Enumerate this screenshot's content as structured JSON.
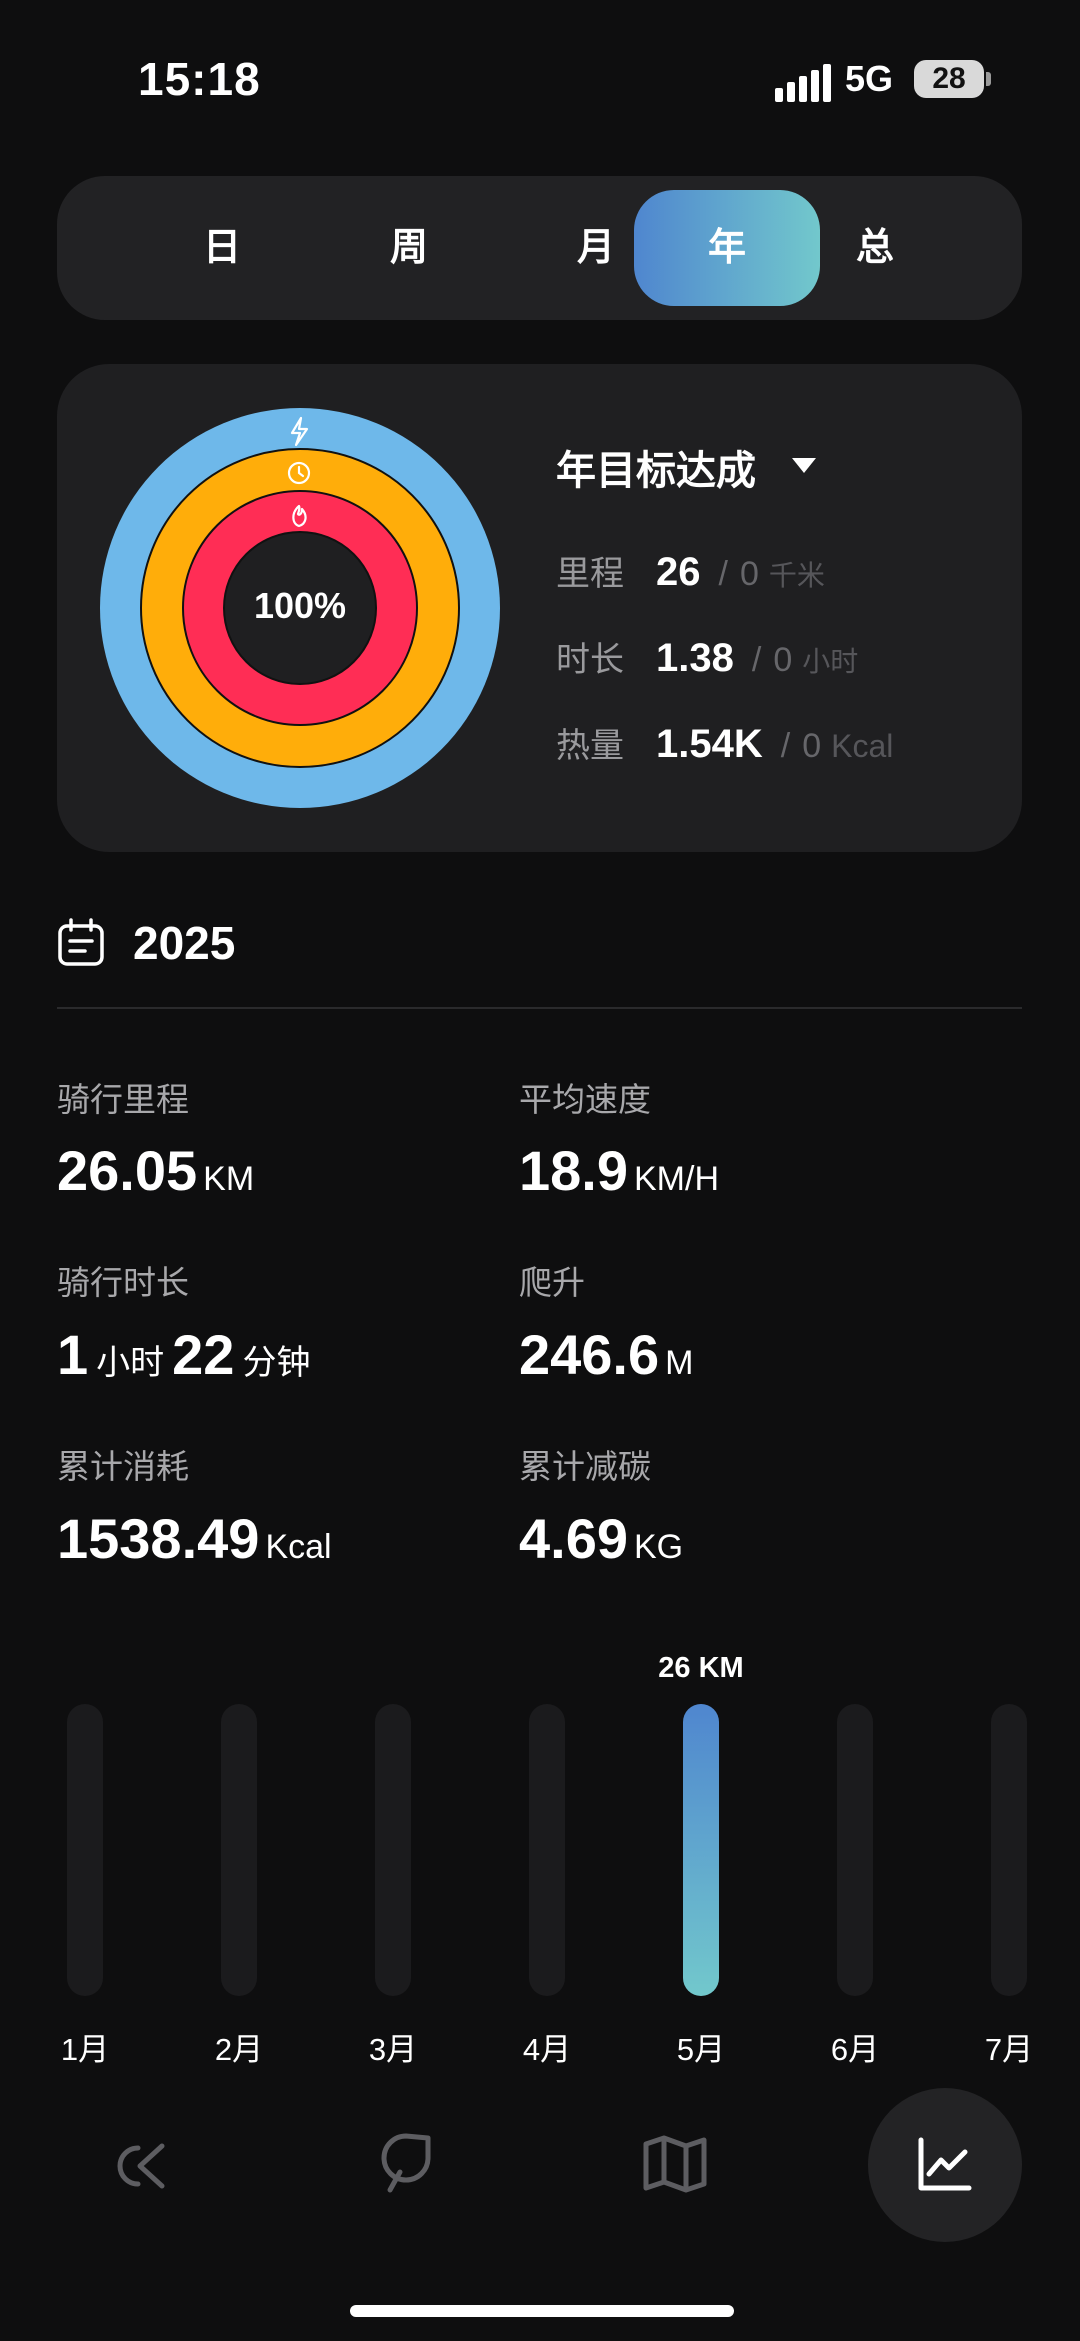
{
  "status_bar": {
    "time": "15:18",
    "network": "5G",
    "battery": "28"
  },
  "tabs": [
    {
      "label": "日",
      "active": false
    },
    {
      "label": "周",
      "active": false
    },
    {
      "label": "月",
      "active": false
    },
    {
      "label": "年",
      "active": true
    },
    {
      "label": "总",
      "active": false
    }
  ],
  "goal": {
    "percent": "100%",
    "title": "年目标达成",
    "rows": [
      {
        "label": "里程",
        "value": "26",
        "sep": "/",
        "target": "0",
        "unit": "千米"
      },
      {
        "label": "时长",
        "value": "1.38",
        "sep": "/",
        "target": "0",
        "unit": "小时"
      },
      {
        "label": "热量",
        "value": "1.54K",
        "sep": "/",
        "target": "0",
        "unit": "Kcal"
      }
    ],
    "ring_colors": {
      "outer": "#6eb8ea",
      "middle": "#ffad0a",
      "inner": "#ff2d55"
    }
  },
  "year": "2025",
  "stats": {
    "distance": {
      "label": "骑行里程",
      "value": "26.05",
      "unit": "KM"
    },
    "avg_speed": {
      "label": "平均速度",
      "value": "18.9",
      "unit": "KM/H"
    },
    "duration": {
      "label": "骑行时长",
      "hours": "1",
      "hours_unit": "小时",
      "minutes": "22",
      "minutes_unit": "分钟"
    },
    "climb": {
      "label": "爬升",
      "value": "246.6",
      "unit": "M"
    },
    "calories": {
      "label": "累计消耗",
      "value": "1538.49",
      "unit": "Kcal"
    },
    "carbon": {
      "label": "累计减碳",
      "value": "4.69",
      "unit": "KG"
    }
  },
  "chart_data": {
    "type": "bar",
    "categories": [
      "1月",
      "2月",
      "3月",
      "4月",
      "5月",
      "6月",
      "7月"
    ],
    "values": [
      0,
      0,
      0,
      0,
      26,
      0,
      0
    ],
    "unit": "KM",
    "annotation": "26 KM",
    "highlight_index": 4
  },
  "nav": [
    {
      "icon": "ride-icon",
      "active": false
    },
    {
      "icon": "leaf-icon",
      "active": false
    },
    {
      "icon": "map-icon",
      "active": false
    },
    {
      "icon": "stats-chart-icon",
      "active": true
    }
  ]
}
